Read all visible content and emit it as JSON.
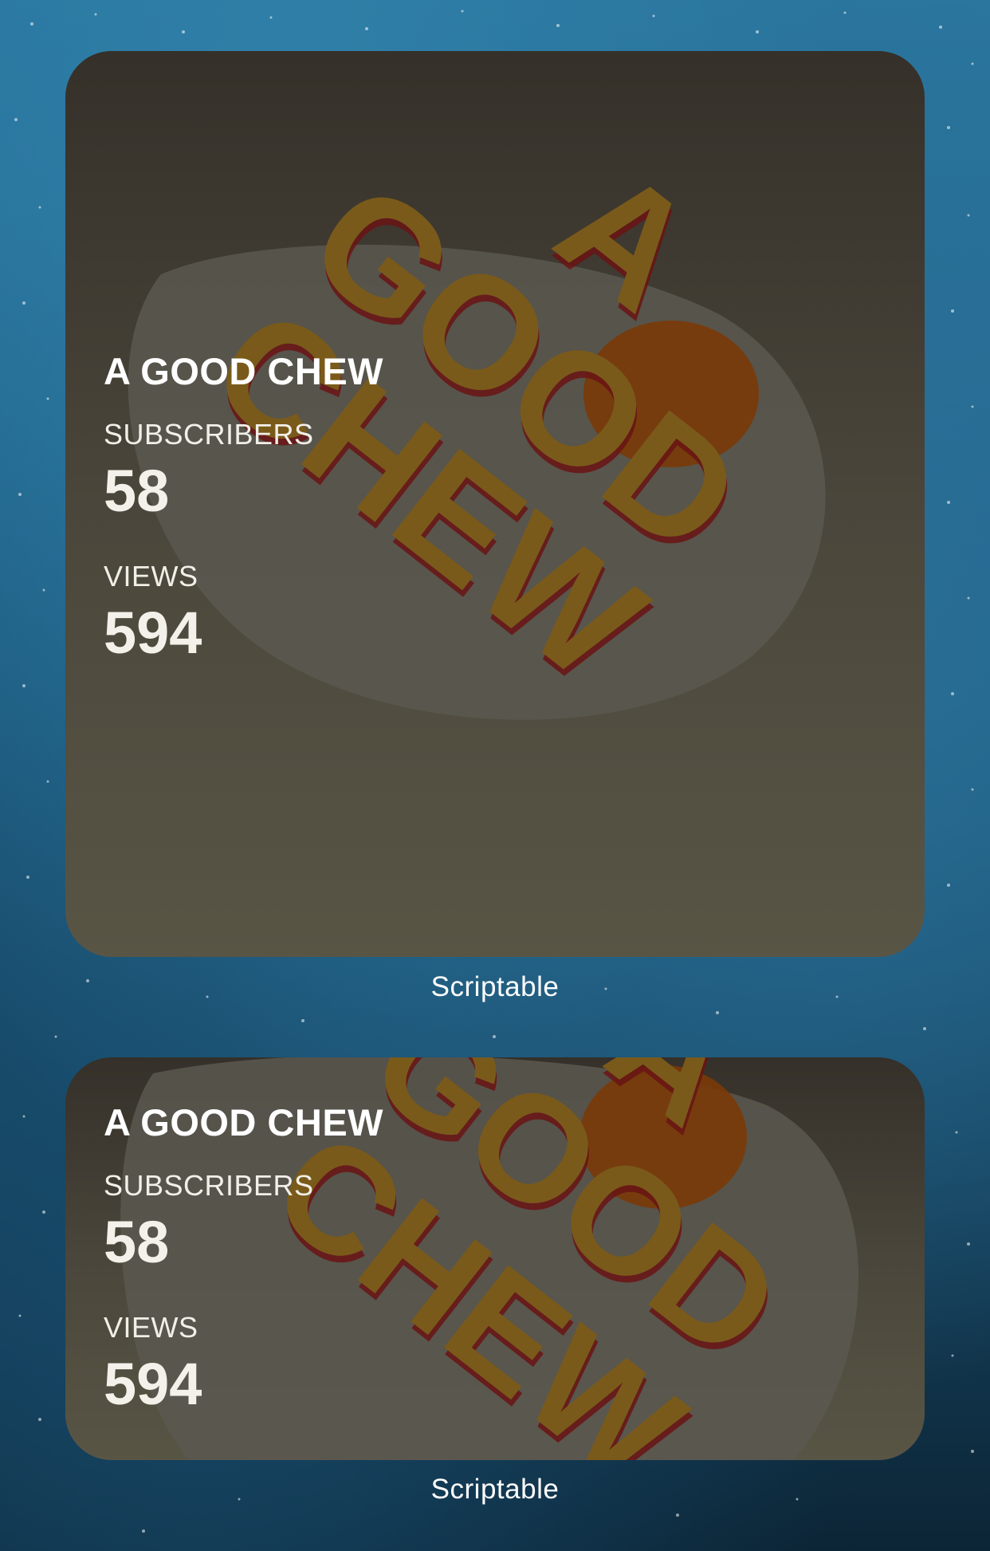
{
  "widgets": [
    {
      "size": "large",
      "title": "A GOOD CHEW",
      "subscribers_label": "SUBSCRIBERS",
      "subscribers_value": "58",
      "views_label": "VIEWS",
      "views_value": "594",
      "app_name": "Scriptable"
    },
    {
      "size": "medium",
      "title": "A GOOD CHEW",
      "subscribers_label": "SUBSCRIBERS",
      "subscribers_value": "58",
      "views_label": "VIEWS",
      "views_value": "594",
      "app_name": "Scriptable"
    }
  ],
  "artwork": {
    "text_line_1": "A",
    "text_line_2": "GOOD",
    "text_line_3": "CHEW",
    "letter_color": "#7a5a1a",
    "shadow_color": "#6a1414",
    "yolk_color": "#7a3a08",
    "plate_color": "#5a5850"
  },
  "colors": {
    "wallpaper_top": "#2a77a0",
    "wallpaper_bottom": "#0c2536",
    "widget_top": "#353029",
    "widget_bottom": "#595545"
  }
}
